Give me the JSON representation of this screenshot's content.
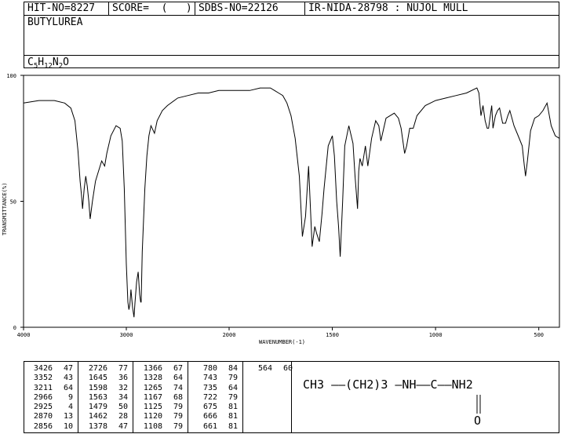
{
  "header": {
    "hit_no": "HIT-NO=8227",
    "score": "SCORE=  (   )",
    "sdbs_no": "SDBS-NO=22126",
    "ir_info": "IR-NIDA-28798 : NUJOL MULL",
    "compound_name": "BUTYLUREA",
    "formula_parts": [
      "C",
      "5",
      "H",
      "12",
      "N",
      "2",
      "O"
    ]
  },
  "chart_data": {
    "type": "line",
    "xlabel": "WAVENUMBER(-1)",
    "ylabel": "TRANSMITTANCE(%)",
    "xlim": [
      4000,
      400
    ],
    "ylim": [
      0,
      100
    ],
    "x_ticks": [
      4000,
      3000,
      2000,
      1500,
      1000,
      500
    ],
    "y_ticks": [
      0,
      50,
      100
    ],
    "grid": false,
    "series": [
      {
        "x": [
          4000,
          3850,
          3700,
          3600,
          3540,
          3500,
          3470,
          3450,
          3435,
          3426,
          3410,
          3395,
          3380,
          3365,
          3352,
          3330,
          3300,
          3270,
          3240,
          3211,
          3190,
          3150,
          3100,
          3060,
          3040,
          3020,
          3000,
          2985,
          2975,
          2966,
          2955,
          2940,
          2925,
          2915,
          2900,
          2885,
          2870,
          2860,
          2856,
          2845,
          2820,
          2800,
          2780,
          2760,
          2726,
          2700,
          2650,
          2600,
          2500,
          2400,
          2300,
          2200,
          2100,
          2000,
          1900,
          1850,
          1800,
          1780,
          1760,
          1740,
          1720,
          1700,
          1680,
          1660,
          1645,
          1630,
          1615,
          1598,
          1585,
          1575,
          1563,
          1550,
          1540,
          1520,
          1500,
          1490,
          1479,
          1470,
          1462,
          1450,
          1440,
          1420,
          1400,
          1390,
          1378,
          1372,
          1366,
          1355,
          1340,
          1328,
          1310,
          1290,
          1275,
          1265,
          1240,
          1200,
          1180,
          1167,
          1150,
          1140,
          1125,
          1120,
          1108,
          1090,
          1050,
          1000,
          950,
          900,
          850,
          800,
          790,
          780,
          770,
          760,
          750,
          743,
          735,
          728,
          722,
          710,
          700,
          690,
          675,
          666,
          661,
          650,
          640,
          620,
          600,
          580,
          570,
          564,
          555,
          540,
          520,
          500,
          480,
          460,
          440,
          420,
          400
        ],
        "y": [
          89,
          90,
          90,
          89,
          87,
          82,
          70,
          58,
          52,
          47,
          55,
          60,
          56,
          50,
          43,
          50,
          58,
          62,
          66,
          64,
          69,
          76,
          80,
          79,
          74,
          55,
          25,
          10,
          7,
          9,
          15,
          8,
          4,
          10,
          18,
          22,
          13,
          10,
          10,
          30,
          55,
          68,
          76,
          80,
          77,
          82,
          86,
          88,
          91,
          92,
          93,
          93,
          94,
          94,
          94,
          95,
          95,
          94,
          93,
          92,
          89,
          84,
          75,
          60,
          36,
          44,
          64,
          32,
          40,
          37,
          34,
          45,
          55,
          72,
          76,
          68,
          50,
          40,
          28,
          50,
          72,
          80,
          73,
          60,
          47,
          62,
          67,
          64,
          72,
          64,
          75,
          82,
          80,
          74,
          83,
          85,
          83,
          79,
          69,
          72,
          79,
          79,
          79,
          84,
          88,
          90,
          91,
          92,
          93,
          95,
          93,
          84,
          88,
          82,
          79,
          79,
          84,
          88,
          79,
          84,
          86,
          87,
          81,
          81,
          81,
          84,
          86,
          80,
          76,
          72,
          64,
          60,
          66,
          78,
          83,
          84,
          86,
          89,
          80,
          76,
          75
        ]
      }
    ]
  },
  "peaks": {
    "columns": [
      [
        [
          "3426",
          "47"
        ],
        [
          "3352",
          "43"
        ],
        [
          "3211",
          "64"
        ],
        [
          "2966",
          "9"
        ],
        [
          "2925",
          "4"
        ],
        [
          "2870",
          "13"
        ],
        [
          "2856",
          "10"
        ]
      ],
      [
        [
          "2726",
          "77"
        ],
        [
          "1645",
          "36"
        ],
        [
          "1598",
          "32"
        ],
        [
          "1563",
          "34"
        ],
        [
          "1479",
          "50"
        ],
        [
          "1462",
          "28"
        ],
        [
          "1378",
          "47"
        ]
      ],
      [
        [
          "1366",
          "67"
        ],
        [
          "1328",
          "64"
        ],
        [
          "1265",
          "74"
        ],
        [
          "1167",
          "68"
        ],
        [
          "1125",
          "79"
        ],
        [
          "1120",
          "79"
        ],
        [
          "1108",
          "79"
        ]
      ],
      [
        [
          "780",
          "84"
        ],
        [
          "743",
          "79"
        ],
        [
          "735",
          "64"
        ],
        [
          "722",
          "79"
        ],
        [
          "675",
          "81"
        ],
        [
          "666",
          "81"
        ],
        [
          "661",
          "81"
        ]
      ],
      [
        [
          "564",
          "60"
        ]
      ]
    ]
  },
  "structure": {
    "text": "CH3 ——(CH2)3 —NH——C——NH2",
    "oxygen": "O"
  }
}
